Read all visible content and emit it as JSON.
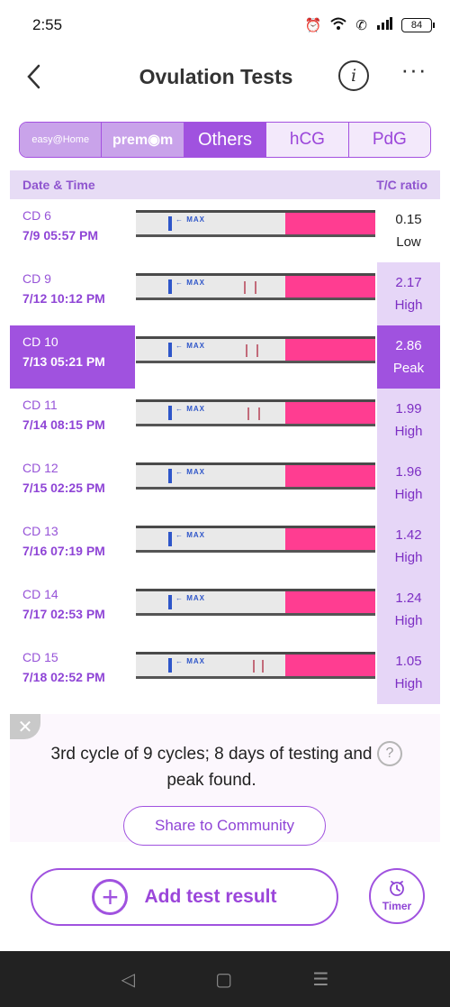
{
  "status_bar": {
    "time": "2:55",
    "battery": "84"
  },
  "header": {
    "title": "Ovulation Tests",
    "info_glyph": "i",
    "more_glyph": "···"
  },
  "tabs": [
    {
      "label": "easy@Home",
      "style": "brand"
    },
    {
      "label": "prem◉m",
      "style": "brand2"
    },
    {
      "label": "Others",
      "style": "active"
    },
    {
      "label": "hCG",
      "style": "plain"
    },
    {
      "label": "PdG",
      "style": "plain"
    }
  ],
  "table": {
    "col_date": "Date & Time",
    "col_ratio": "T/C ratio",
    "strip_label": "← MAX",
    "rows": [
      {
        "cd": "CD 6",
        "datetime": "7/9  05:57 PM",
        "ratio": "0.15",
        "level": "Low",
        "selected": false
      },
      {
        "cd": "CD 9",
        "datetime": "7/12  10:12 PM",
        "ratio": "2.17",
        "level": "High",
        "selected": false
      },
      {
        "cd": "CD 10",
        "datetime": "7/13  05:21 PM",
        "ratio": "2.86",
        "level": "Peak",
        "selected": true
      },
      {
        "cd": "CD 11",
        "datetime": "7/14  08:15 PM",
        "ratio": "1.99",
        "level": "High",
        "selected": false
      },
      {
        "cd": "CD 12",
        "datetime": "7/15  02:25 PM",
        "ratio": "1.96",
        "level": "High",
        "selected": false
      },
      {
        "cd": "CD 13",
        "datetime": "7/16  07:19 PM",
        "ratio": "1.42",
        "level": "High",
        "selected": false
      },
      {
        "cd": "CD 14",
        "datetime": "7/17  02:53 PM",
        "ratio": "1.24",
        "level": "High",
        "selected": false
      },
      {
        "cd": "CD 15",
        "datetime": "7/18  02:52 PM",
        "ratio": "1.05",
        "level": "High",
        "selected": false
      }
    ]
  },
  "summary": {
    "text": "3rd cycle of 9 cycles; 8 days of testing and peak found.",
    "share_label": "Share to Community"
  },
  "actions": {
    "add_label": "Add test result",
    "timer_label": "Timer"
  },
  "nav": {
    "back": "◁",
    "home": "▢",
    "menu": "☰"
  },
  "colors": {
    "accent": "#a052df",
    "accent_light": "#e6d6f7",
    "strip_pink": "#ff3d91",
    "strip_blue": "#2f56c9"
  }
}
